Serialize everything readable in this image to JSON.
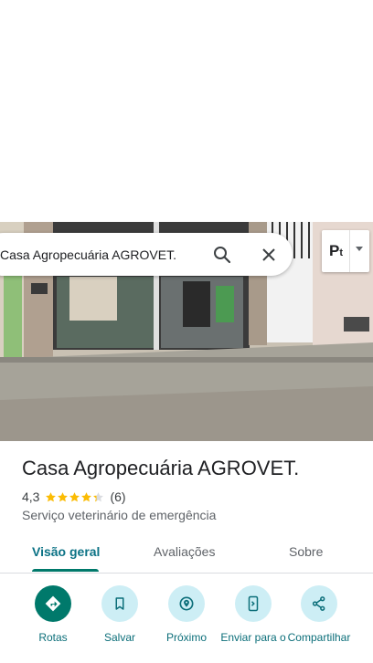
{
  "search": {
    "query": "Casa Agropecuária AGROVET."
  },
  "layer_toggle": {
    "label_main": "P",
    "label_sub": "t"
  },
  "place": {
    "title": "Casa Agropecuária AGROVET.",
    "rating": "4,3",
    "stars": 4.3,
    "review_count": "(6)",
    "category": "Serviço veterinário de emergência"
  },
  "tabs": [
    {
      "label": "Visão geral",
      "active": true
    },
    {
      "label": "Avaliações",
      "active": false
    },
    {
      "label": "Sobre",
      "active": false
    }
  ],
  "actions": [
    {
      "label": "Rotas",
      "icon": "directions-icon"
    },
    {
      "label": "Salvar",
      "icon": "bookmark-icon"
    },
    {
      "label": "Próximo",
      "icon": "nearby-icon"
    },
    {
      "label": "Enviar para o",
      "icon": "send-to-phone-icon"
    },
    {
      "label": "Compartilhar",
      "icon": "share-icon"
    }
  ],
  "colors": {
    "accent": "#00796b",
    "action_bg": "#cdeef5",
    "action_text": "#0b6e79",
    "star": "#fbbc04"
  }
}
